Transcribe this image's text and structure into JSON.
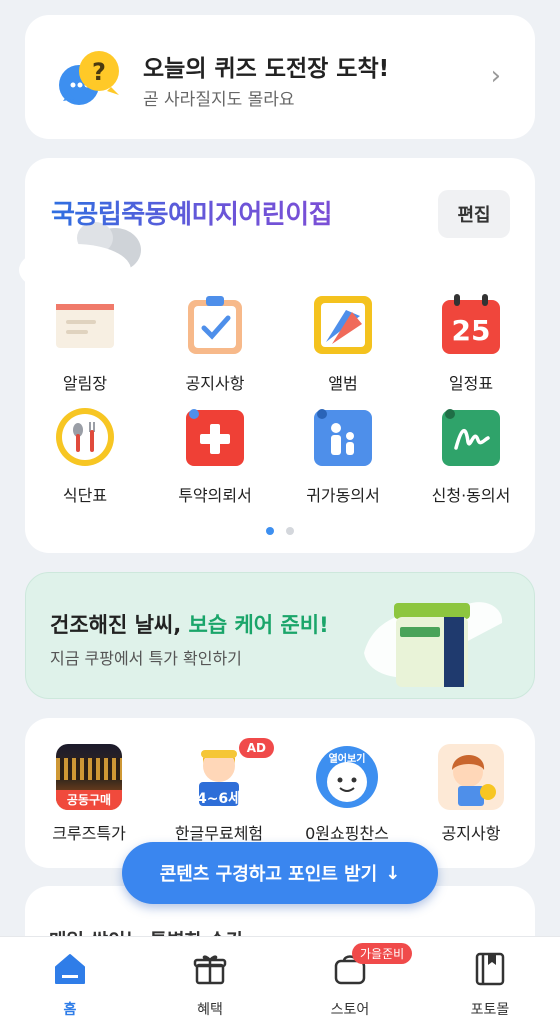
{
  "quiz": {
    "title": "오늘의 퀴즈 도전장 도착!",
    "subtitle": "곧 사라질지도 몰라요"
  },
  "daycare": {
    "name": "국공립죽동예미지어린이집",
    "edit_label": "편집",
    "items": [
      {
        "label": "알림장",
        "icon": "notebook-icon"
      },
      {
        "label": "공지사항",
        "icon": "clipboard-check-icon"
      },
      {
        "label": "앨범",
        "icon": "album-icon"
      },
      {
        "label": "일정표",
        "icon": "calendar-icon",
        "day": "25"
      },
      {
        "label": "식단표",
        "icon": "meal-icon"
      },
      {
        "label": "투약의뢰서",
        "icon": "medicine-icon"
      },
      {
        "label": "귀가동의서",
        "icon": "parent-child-icon"
      },
      {
        "label": "신청·동의서",
        "icon": "signature-icon"
      }
    ],
    "page_count": 2,
    "current_page": 1
  },
  "banner": {
    "title_prefix": "건조해진 날씨, ",
    "title_highlight": "보습 케어 준비!",
    "subtitle": "지금 쿠팡에서 특가 확인하기"
  },
  "shortcuts": [
    {
      "label": "크루즈특가",
      "tag": "공동구매"
    },
    {
      "label": "한글무료체험",
      "tag": "4~6세",
      "badge": "AD"
    },
    {
      "label": "0원쇼핑찬스",
      "tag": "열어보기"
    },
    {
      "label": "공지사항"
    }
  ],
  "peek": {
    "text": "매일 쌓이는 특별한 순간"
  },
  "cta": {
    "label": "콘텐츠 구경하고 포인트 받기",
    "arrow": "↓"
  },
  "tabs": [
    {
      "label": "홈",
      "icon": "home-icon",
      "active": true
    },
    {
      "label": "혜택",
      "icon": "gift-icon"
    },
    {
      "label": "스토어",
      "icon": "store-bag-icon",
      "badge": "가을준비"
    },
    {
      "label": "포토몰",
      "icon": "photobook-icon"
    }
  ],
  "colors": {
    "accent": "#3a86ef",
    "banner_bg": "#dff2ea",
    "highlight_green": "#1aa56a",
    "badge_red": "#f04a4a"
  }
}
